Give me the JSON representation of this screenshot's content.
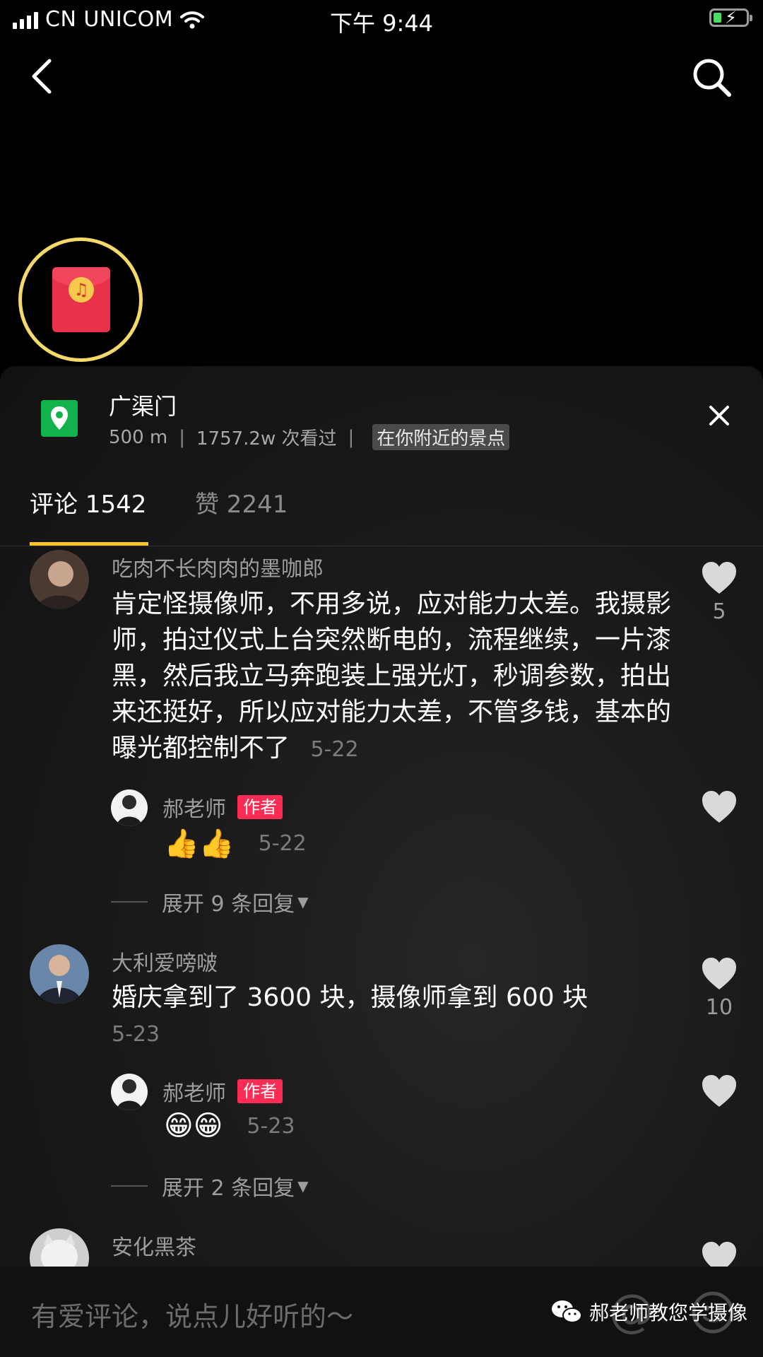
{
  "status_bar": {
    "carrier": "CN UNICOM",
    "time": "下午 9:44"
  },
  "location": {
    "name": "广渠门",
    "distance": "500 m",
    "views": "1757.2w 次看过",
    "separator": "|",
    "tag": "在你附近的景点"
  },
  "tabs": {
    "comments_label": "评论 1542",
    "likes_label": "赞 2241"
  },
  "comments": [
    {
      "username": "吃肉不长肉肉的墨咖郎",
      "text": "肯定怪摄像师，不用多说，应对能力太差。我摄影师，拍过仪式上台突然断电的，流程继续，一片漆黑，然后我立马奔跑装上强光灯，秒调参数，拍出来还挺好，所以应对能力太差，不管多钱，基本的曝光都控制不了",
      "time": "5-22",
      "likes": "5",
      "reply": {
        "username": "郝老师",
        "badge": "作者",
        "emojis": "👍👍",
        "time": "5-22"
      },
      "expand": "展开 9 条回复"
    },
    {
      "username": "大利爱嗙啵",
      "text": "婚庆拿到了 3600 块，摄像师拿到 600 块",
      "time": "5-23",
      "likes": "10",
      "reply": {
        "username": "郝老师",
        "badge": "作者",
        "emojis": "😁😁",
        "time": "5-23"
      },
      "expand": "展开 2 条回复"
    },
    {
      "username": "安化黑茶"
    }
  ],
  "input": {
    "placeholder": "有爱评论，说点儿好听的～"
  },
  "watermark": "郝老师教您学摄像",
  "colors": {
    "accent_yellow": "#f9c42c",
    "author_badge": "#fe2c55",
    "location_green": "#12b24c",
    "red_packet": "#e8324a"
  }
}
